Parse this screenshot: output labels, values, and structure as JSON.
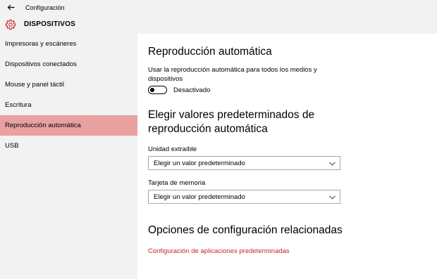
{
  "titlebar": {
    "title": "Configuración"
  },
  "header": {
    "section_title": "DISPOSITIVOS"
  },
  "sidebar": {
    "items": [
      {
        "label": "Impresoras y escáneres"
      },
      {
        "label": "Dispositivos conectados"
      },
      {
        "label": "Mouse y panel táctil"
      },
      {
        "label": "Escritura"
      },
      {
        "label": "Reproducción automática"
      },
      {
        "label": "USB"
      }
    ],
    "active_index": 4
  },
  "main": {
    "autoplay_heading": "Reproducción automática",
    "autoplay_description": "Usar la reproducción automática para todos los medios y dispositivos",
    "autoplay_toggle_state": "Desactivado",
    "defaults_heading": "Elegir valores predeterminados de reproducción automática",
    "removable_drive_label": "Unidad extraíble",
    "removable_drive_value": "Elegir un valor predeterminado",
    "memory_card_label": "Tarjeta de memoria",
    "memory_card_value": "Elegir un valor predeterminado",
    "related_heading": "Opciones de configuración relacionadas",
    "related_link": "Configuración de aplicaciones predeterminadas"
  },
  "icons": {
    "back": "back-arrow-icon",
    "section": "gear-icon",
    "dropdown": "chevron-down-icon"
  },
  "colors": {
    "accent": "#c4262e",
    "nav_selected": "#e8a0a0",
    "pane_background": "#f2f2f2"
  }
}
